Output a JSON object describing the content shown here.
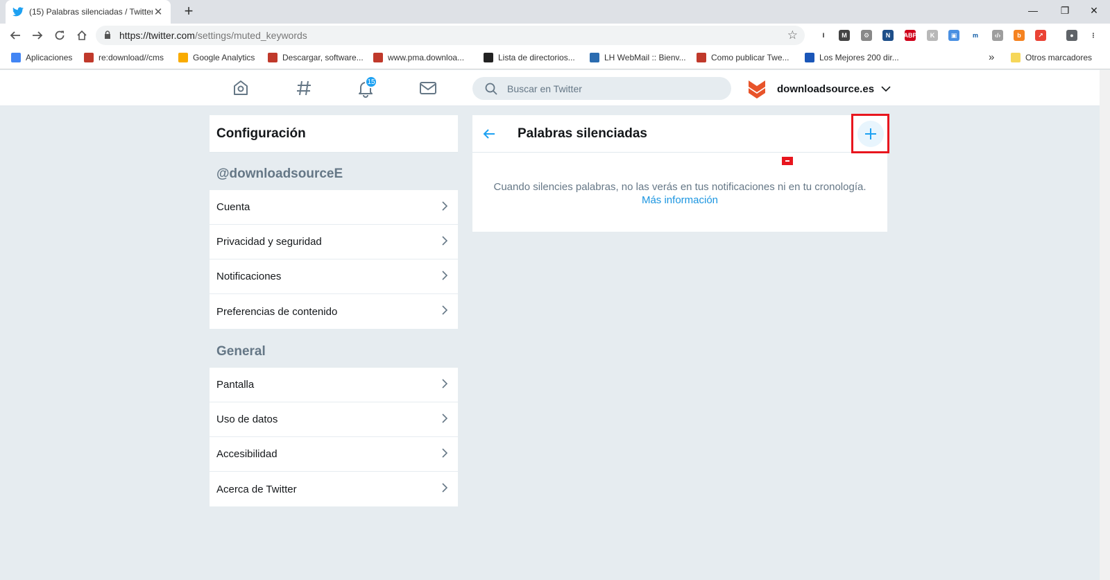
{
  "browser": {
    "tab_title": "(15) Palabras silenciadas / Twitter",
    "tab_close": "✕",
    "new_tab": "+",
    "window_controls": [
      "—",
      "❐",
      "✕"
    ],
    "url_host": "https://twitter.com",
    "url_path": "/settings/muted_keywords",
    "bookmarks": [
      {
        "label": "Aplicaciones",
        "color": "#4285f4"
      },
      {
        "label": "re:download//cms",
        "color": "#c0392b"
      },
      {
        "label": "Google Analytics",
        "color": "#f9ab00"
      },
      {
        "label": "Descargar, software...",
        "color": "#c0392b"
      },
      {
        "label": "www.pma.downloa...",
        "color": "#c0392b"
      },
      {
        "label": "Lista de directorios...",
        "color": "#222222"
      },
      {
        "label": "LH WebMail :: Bienv...",
        "color": "#2b6cb0"
      },
      {
        "label": "Como publicar Twe...",
        "color": "#c0392b"
      },
      {
        "label": "Los Mejores 200 dir...",
        "color": "#1a56b8"
      }
    ],
    "bookmarks_more": "»",
    "other_bookmarks": "Otros marcadores",
    "extensions": [
      {
        "text": "I",
        "color": "#ffffff",
        "fg": "#111111"
      },
      {
        "text": "M",
        "color": "#444444",
        "fg": "#ffffff"
      },
      {
        "text": "⚙",
        "color": "#888888",
        "fg": "#ffffff"
      },
      {
        "text": "N",
        "color": "#1d4e89",
        "fg": "#ffffff"
      },
      {
        "text": "ABP",
        "color": "#d0021b",
        "fg": "#ffffff"
      },
      {
        "text": "K",
        "color": "#b8b8b8",
        "fg": "#ffffff"
      },
      {
        "text": "▣",
        "color": "#4a90e2",
        "fg": "#ffffff"
      },
      {
        "text": "m",
        "color": "#ffffff",
        "fg": "#0c5aa6"
      },
      {
        "text": "‹/›",
        "color": "#9e9e9e",
        "fg": "#ffffff"
      },
      {
        "text": "b",
        "color": "#f58220",
        "fg": "#ffffff"
      },
      {
        "text": "↗",
        "color": "#ea4335",
        "fg": "#ffffff"
      },
      {
        "text": "●",
        "color": "#5f6368",
        "fg": "#ffffff"
      },
      {
        "text": "⋮",
        "color": "#ffffff",
        "fg": "#333333"
      }
    ]
  },
  "twitter": {
    "notification_count": "15",
    "search_placeholder": "Buscar en Twitter",
    "account_name": "downloadsource.es",
    "brand_color": "#1da1f2"
  },
  "sidebar": {
    "title": "Configuración",
    "account_section": "@downloadsourceE",
    "account_items": [
      {
        "label": "Cuenta"
      },
      {
        "label": "Privacidad y seguridad"
      },
      {
        "label": "Notificaciones"
      },
      {
        "label": "Preferencias de contenido"
      }
    ],
    "general_section": "General",
    "general_items": [
      {
        "label": "Pantalla"
      },
      {
        "label": "Uso de datos"
      },
      {
        "label": "Accesibilidad"
      },
      {
        "label": "Acerca de Twitter"
      }
    ]
  },
  "main": {
    "title": "Palabras silenciadas",
    "message": "Cuando silencies palabras, no las verás en tus notificaciones ni en tu cronología.",
    "learn_more": "Más información"
  }
}
